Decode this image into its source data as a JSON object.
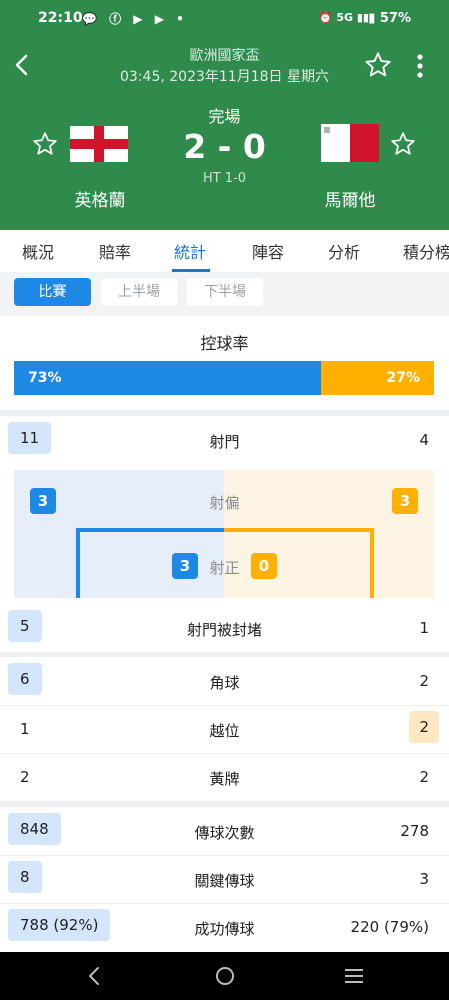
{
  "status_bar": {
    "time": "22:10",
    "notif_icons": [
      "chat-bubble-icon",
      "facebook-icon",
      "youtube-icon",
      "youtube-icon",
      "dot-icon"
    ],
    "network": "5G",
    "battery": "57%"
  },
  "header": {
    "competition": "歐洲國家盃",
    "datetime": "03:45, 2023年11月18日 星期六",
    "status": "完場",
    "score": "2 - 0",
    "half_time": "HT 1-0",
    "home_team": "英格蘭",
    "away_team": "馬爾他"
  },
  "tabs": [
    "概況",
    "賠率",
    "統計",
    "陣容",
    "分析",
    "積分榜"
  ],
  "active_tab": "統計",
  "periods": [
    "比賽",
    "上半場",
    "下半場"
  ],
  "active_period": "比賽",
  "possession": {
    "label": "控球率",
    "home": "73%",
    "away": "27%",
    "home_fraction": 0.73
  },
  "shots": {
    "label": "射門",
    "home": "11",
    "away": "4",
    "off_target_label": "射偏",
    "off_home": "3",
    "off_away": "3",
    "on_target_label": "射正",
    "on_home": "3",
    "on_away": "0"
  },
  "blocked": {
    "label": "射門被封堵",
    "home": "5",
    "away": "1"
  },
  "set_pieces": [
    {
      "label": "角球",
      "home": "6",
      "away": "2"
    },
    {
      "label": "越位",
      "home": "1",
      "away": "2"
    },
    {
      "label": "黃牌",
      "home": "2",
      "away": "2"
    }
  ],
  "passing": [
    {
      "label": "傳球次數",
      "home": "848",
      "away": "278"
    },
    {
      "label": "關鍵傳球",
      "home": "8",
      "away": "3"
    },
    {
      "label": "成功傳球",
      "home": "788 (92%)",
      "away": "220 (79%)"
    }
  ],
  "colors": {
    "header_green": "#2e8b4b",
    "home_blue": "#1e88e5",
    "away_orange": "#ffb000"
  }
}
